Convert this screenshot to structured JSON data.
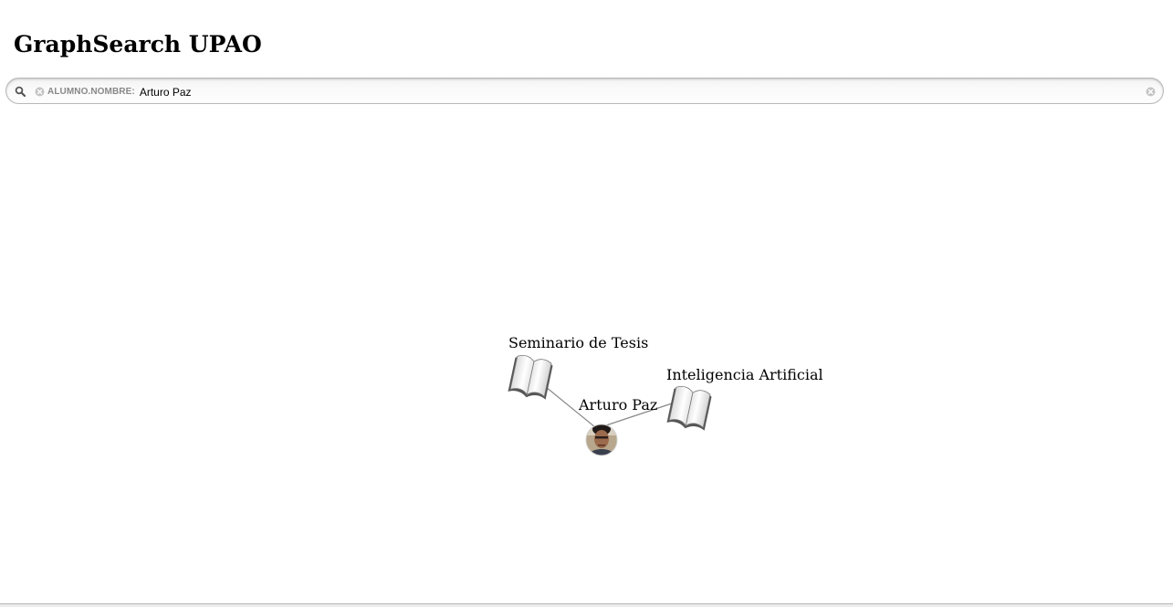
{
  "header": {
    "title": "GraphSearch UPAO"
  },
  "search": {
    "icon": "search-icon",
    "facet": {
      "category": "ALUMNO.NOMBRE:",
      "value": "Arturo Paz"
    },
    "clear_icon": "clear-icon"
  },
  "graph": {
    "center_node": {
      "label": "Arturo Paz",
      "type": "student",
      "icon": "student-photo-avatar"
    },
    "course_nodes": [
      {
        "label": "Seminario de Tesis",
        "type": "course",
        "icon": "book-icon"
      },
      {
        "label": "Inteligencia Artificial",
        "type": "course",
        "icon": "book-icon"
      }
    ],
    "edge_color": "#888888"
  }
}
